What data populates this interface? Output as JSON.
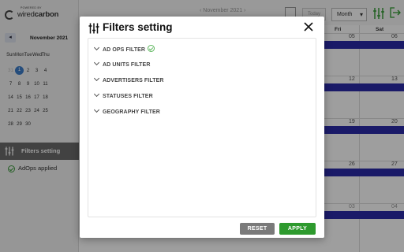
{
  "app": {
    "logo": {
      "powered_by": "POWERED BY",
      "name_part1": "wired",
      "name_part2": "carbon"
    },
    "mini_calendar": {
      "prev_label": "◂",
      "title": "November 2021",
      "dows": [
        "Sun",
        "Mon",
        "Tue",
        "Wed",
        "Thu"
      ],
      "weeks": [
        [
          "31",
          "1",
          "2",
          "3",
          "4"
        ],
        [
          "7",
          "8",
          "9",
          "10",
          "11"
        ],
        [
          "14",
          "15",
          "16",
          "17",
          "18"
        ],
        [
          "21",
          "22",
          "23",
          "24",
          "25"
        ],
        [
          "28",
          "29",
          "30",
          "",
          ""
        ]
      ],
      "selected_day": "1"
    },
    "sidebar": {
      "filters_setting_label": "Filters setting",
      "applied_label": "AdOps applied"
    },
    "toolbar": {
      "month_nav_label": "‹   November 2021   ›",
      "today_label": "Today",
      "view_select_value": "Month"
    },
    "calendar": {
      "day_headers": {
        "fri": "Fri",
        "sat": "Sat"
      },
      "day_numbers": {
        "r1_sat": "06",
        "r1_fri": "05",
        "r2_fri": "12",
        "r2_sat": "13",
        "r3_fri": "19",
        "r3_sat": "20",
        "r4_fri": "26",
        "r4_sat": "27",
        "r5_fri": "03",
        "r5_sat": "04"
      },
      "event_color": "#2a2aa8"
    }
  },
  "modal": {
    "title": "Filters setting",
    "filters": [
      {
        "label": "AD OPS FILTER",
        "applied": true
      },
      {
        "label": "AD UNITS FILTER",
        "applied": false
      },
      {
        "label": "ADVERTISERS FILTER",
        "applied": false
      },
      {
        "label": "STATUSES FILTER",
        "applied": false
      },
      {
        "label": "GEOGRAPHY FILTER",
        "applied": false
      }
    ],
    "reset_label": "RESET",
    "apply_label": "APPLY",
    "colors": {
      "reset": "#7a7a7a",
      "apply": "#2e9a2e",
      "applied_check": "#5ab55a"
    },
    "icons": {
      "title_icon": "sliders-icon",
      "close_icon": "close-icon",
      "row_icon": "chevron-down-icon",
      "applied_icon": "check-circle-icon"
    }
  }
}
